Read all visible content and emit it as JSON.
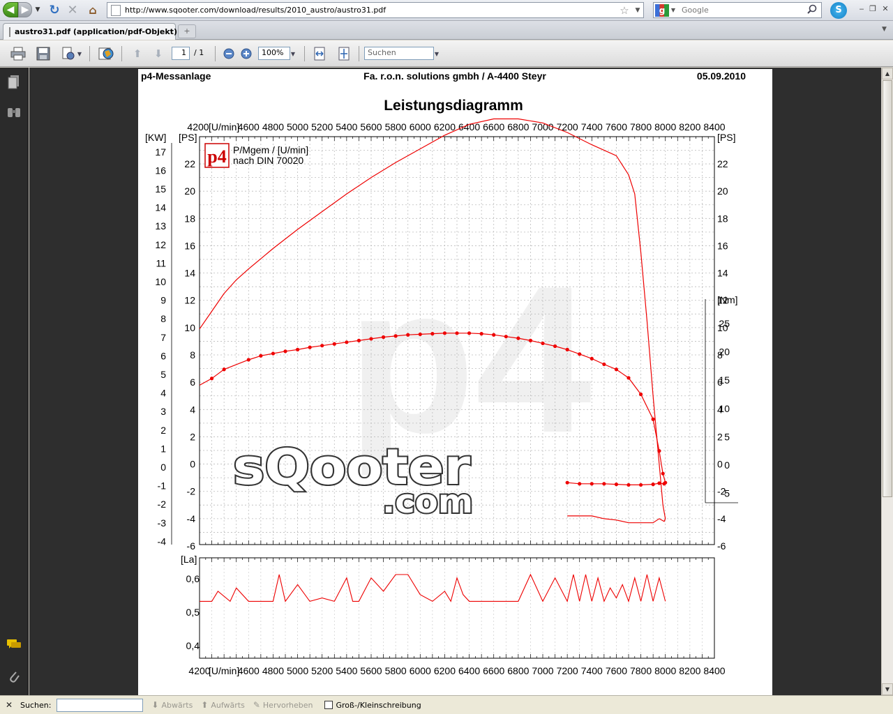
{
  "browser": {
    "url": "http://www.sqooter.com/download/results/2010_austro/austro31.pdf",
    "search_engine": "Google",
    "search_placeholder": "Google",
    "tab_title": "austro31.pdf (application/pdf-Objekt)",
    "new_tab_icon": "+"
  },
  "pdf_toolbar": {
    "page_current": "1",
    "page_total": "/ 1",
    "zoom": "100%",
    "search_placeholder": "Suchen"
  },
  "document": {
    "header_left": "p4-Messanlage",
    "header_center": "Fa. r.o.n. solutions gmbh / A-4400 Steyr",
    "header_right": "05.09.2010",
    "title": "Leistungsdiagramm",
    "legend_line1": "P/Mgem / [U/min]",
    "legend_line2": "nach DIN 70020",
    "logo_text": "p4",
    "watermark": "p4",
    "brand_line1": "sQooter",
    "brand_line2": ".com"
  },
  "chart_data": [
    {
      "type": "line",
      "title": "Leistungsdiagramm",
      "xlabel": "[U/min]",
      "x_ticks": [
        "4200",
        "[U/min]",
        "4600",
        "4800",
        "5000",
        "5200",
        "5400",
        "5600",
        "5800",
        "6000",
        "6200",
        "6400",
        "6600",
        "6800",
        "7000",
        "7200",
        "7400",
        "7600",
        "7800",
        "8000",
        "8200",
        "8400"
      ],
      "xlim": [
        4200,
        8400
      ],
      "axes": {
        "kw": {
          "label": "[KW]",
          "ticks": [
            "17",
            "16",
            "15",
            "14",
            "13",
            "12",
            "11",
            "10",
            "9",
            "8",
            "7",
            "6",
            "5",
            "4",
            "3",
            "2",
            "1",
            "0",
            "-1",
            "-2",
            "-3",
            "-4"
          ],
          "ylim": [
            -4.5,
            17.5
          ]
        },
        "ps_left": {
          "label": "[PS]",
          "ticks": [
            "22",
            "20",
            "18",
            "16",
            "14",
            "12",
            "10",
            "8",
            "6",
            "4",
            "2",
            "0",
            "-2",
            "-4",
            "-6"
          ],
          "ylim": [
            -6,
            24
          ]
        },
        "ps_right": {
          "label": "[PS]",
          "ticks": [
            "22",
            "20",
            "18",
            "16",
            "14",
            "12",
            "10",
            "8",
            "6",
            "4",
            "2",
            "0",
            "-2",
            "-4",
            "-6"
          ]
        },
        "nm": {
          "label": "[Nm]",
          "ticks": [
            "25",
            "20",
            "15",
            "10",
            "5",
            "0",
            "-5"
          ],
          "ylim": [
            -8,
            28
          ]
        }
      },
      "grid": true,
      "legend": "top-left",
      "series": [
        {
          "axis": "ps",
          "x": [
            4200,
            4300,
            4400,
            4500,
            4600,
            4800,
            5000,
            5200,
            5400,
            5600,
            5800,
            6000,
            6200,
            6400,
            6600,
            6800,
            7000,
            7200,
            7400,
            7600,
            7700,
            7750,
            7800,
            7850,
            7900,
            7950,
            7980,
            8000,
            7990,
            7950,
            7900,
            7850,
            7800,
            7700,
            7600,
            7500,
            7400,
            7300,
            7200
          ],
          "y": [
            9.9,
            11.2,
            12.5,
            13.5,
            14.3,
            15.8,
            17.2,
            18.5,
            19.8,
            21.0,
            22.1,
            23.1,
            24.1,
            24.9,
            25.3,
            25.3,
            25.0,
            24.3,
            23.4,
            22.6,
            21.2,
            19.8,
            15.5,
            10.5,
            5.0,
            0.0,
            -3.0,
            -4.0,
            -4.2,
            -4.0,
            -4.3,
            -4.3,
            -4.3,
            -4.3,
            -4.1,
            -4.0,
            -3.8,
            -3.8,
            -3.8
          ]
        },
        {
          "axis": "nm",
          "x": [
            4200,
            4300,
            4400,
            4600,
            4700,
            4800,
            4900,
            5000,
            5100,
            5200,
            5300,
            5400,
            5500,
            5600,
            5700,
            5800,
            5900,
            6000,
            6100,
            6200,
            6300,
            6400,
            6500,
            6600,
            6700,
            6800,
            6900,
            7000,
            7100,
            7200,
            7300,
            7400,
            7500,
            7600,
            7700,
            7800,
            7900,
            7950,
            7980,
            8000,
            7990,
            7950,
            7900,
            7800,
            7700,
            7600,
            7500,
            7400,
            7300,
            7200
          ],
          "y": [
            14.1,
            15.3,
            16.9,
            18.6,
            19.3,
            19.7,
            20.1,
            20.4,
            20.8,
            21.1,
            21.4,
            21.7,
            22.0,
            22.3,
            22.6,
            22.8,
            23.0,
            23.1,
            23.2,
            23.3,
            23.3,
            23.3,
            23.2,
            23.0,
            22.7,
            22.4,
            22.0,
            21.5,
            21.0,
            20.4,
            19.6,
            18.8,
            17.8,
            16.9,
            15.4,
            12.5,
            8.1,
            2.5,
            -1.5,
            -3.1,
            -3.3,
            -3.2,
            -3.4,
            -3.5,
            -3.5,
            -3.4,
            -3.3,
            -3.3,
            -3.3,
            -3.1
          ]
        }
      ]
    },
    {
      "type": "line",
      "xlabel": "[U/min]",
      "ylabel": "[La]",
      "x_ticks": [
        "4200",
        "[U/min]",
        "4600",
        "4800",
        "5000",
        "5200",
        "5400",
        "5600",
        "5800",
        "6000",
        "6200",
        "6400",
        "6600",
        "6800",
        "7000",
        "7200",
        "7400",
        "7600",
        "7800",
        "8000",
        "8200",
        "8400"
      ],
      "y_ticks": [
        "0,6",
        "0,5",
        "0,4"
      ],
      "xlim": [
        4200,
        8400
      ],
      "ylim": [
        0.36,
        0.66
      ],
      "series": [
        {
          "x": [
            4200,
            4300,
            4350,
            4450,
            4500,
            4600,
            4700,
            4800,
            4850,
            4900,
            5000,
            5100,
            5200,
            5300,
            5400,
            5450,
            5500,
            5600,
            5700,
            5800,
            5900,
            6000,
            6100,
            6200,
            6250,
            6300,
            6350,
            6400,
            6500,
            6600,
            6700,
            6800,
            6900,
            7000,
            7100,
            7200,
            7250,
            7300,
            7350,
            7400,
            7450,
            7500,
            7550,
            7600,
            7650,
            7700,
            7750,
            7800,
            7850,
            7900,
            7950,
            8000
          ],
          "y": [
            0.53,
            0.53,
            0.56,
            0.53,
            0.57,
            0.53,
            0.53,
            0.53,
            0.61,
            0.53,
            0.58,
            0.53,
            0.54,
            0.53,
            0.6,
            0.53,
            0.53,
            0.6,
            0.56,
            0.61,
            0.61,
            0.55,
            0.53,
            0.56,
            0.53,
            0.6,
            0.55,
            0.53,
            0.53,
            0.53,
            0.53,
            0.53,
            0.61,
            0.53,
            0.6,
            0.53,
            0.61,
            0.53,
            0.61,
            0.53,
            0.6,
            0.53,
            0.57,
            0.54,
            0.58,
            0.53,
            0.6,
            0.53,
            0.61,
            0.53,
            0.6,
            0.53
          ]
        }
      ]
    }
  ]
}
